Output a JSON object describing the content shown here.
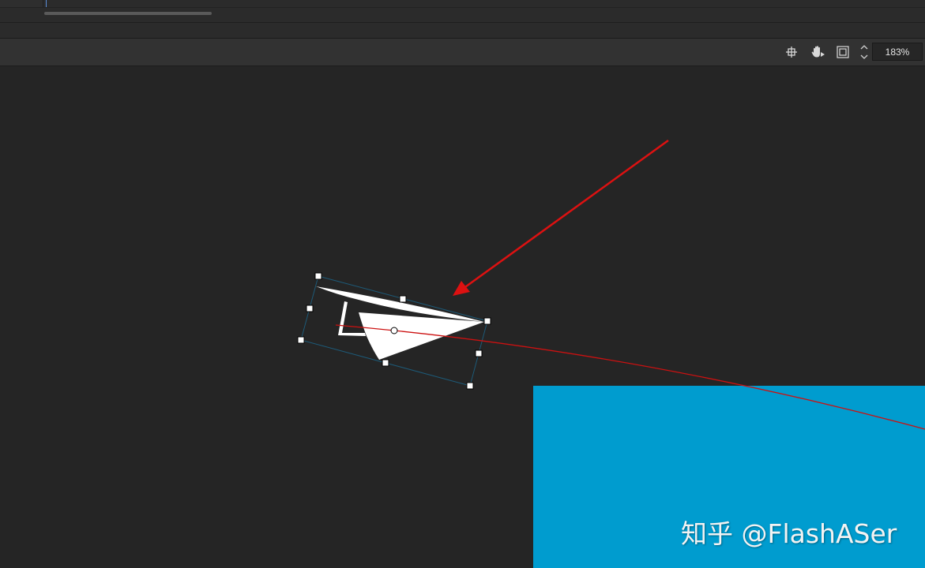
{
  "toolbar": {
    "icons": [
      "center-stage-icon",
      "hand-tool-icon",
      "clip-canvas-icon",
      "zoom-stepper-icon"
    ],
    "zoom_value": "183%"
  },
  "stage": {
    "canvas_color": "#009ccf",
    "motion_path_color": "#cc1111",
    "annotation_arrow_color": "#dd1111",
    "watermark": "知乎 @FlashASer"
  }
}
